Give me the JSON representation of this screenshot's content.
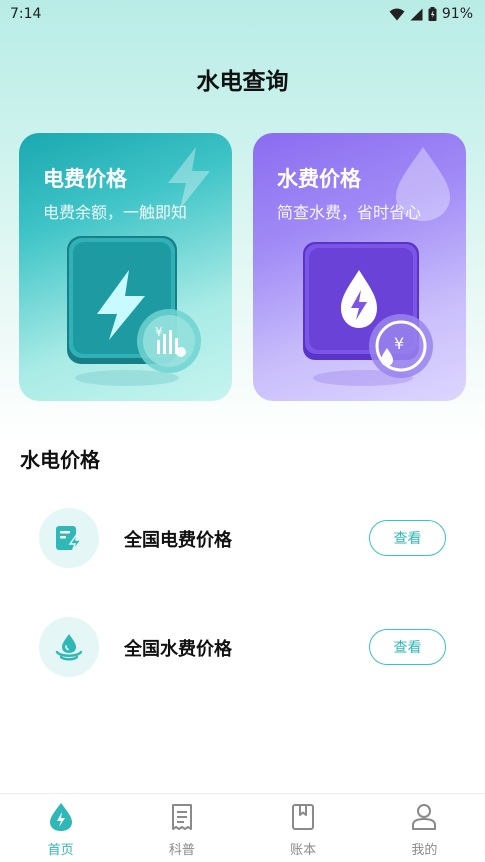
{
  "status_bar": {
    "time": "7:14",
    "battery": "91%"
  },
  "header": {
    "title": "水电查询"
  },
  "cards": {
    "electricity": {
      "title": "电费价格",
      "subtitle": "电费余额，一触即知"
    },
    "water": {
      "title": "水费价格",
      "subtitle": "简查水费，省时省心"
    }
  },
  "section": {
    "title": "水电价格",
    "rows": [
      {
        "label": "全国电费价格",
        "button": "查看",
        "icon": "electricity-doc-icon"
      },
      {
        "label": "全国水费价格",
        "button": "查看",
        "icon": "water-drop-icon"
      }
    ]
  },
  "nav": {
    "items": [
      {
        "label": "首页",
        "icon": "home-drop-icon",
        "active": true
      },
      {
        "label": "科普",
        "icon": "receipt-icon",
        "active": false
      },
      {
        "label": "账本",
        "icon": "book-icon",
        "active": false
      },
      {
        "label": "我的",
        "icon": "user-icon",
        "active": false
      }
    ]
  },
  "colors": {
    "accent": "#2fb8b5",
    "water_accent": "#8a6cf0",
    "elec_accent": "#1aa8b0"
  }
}
